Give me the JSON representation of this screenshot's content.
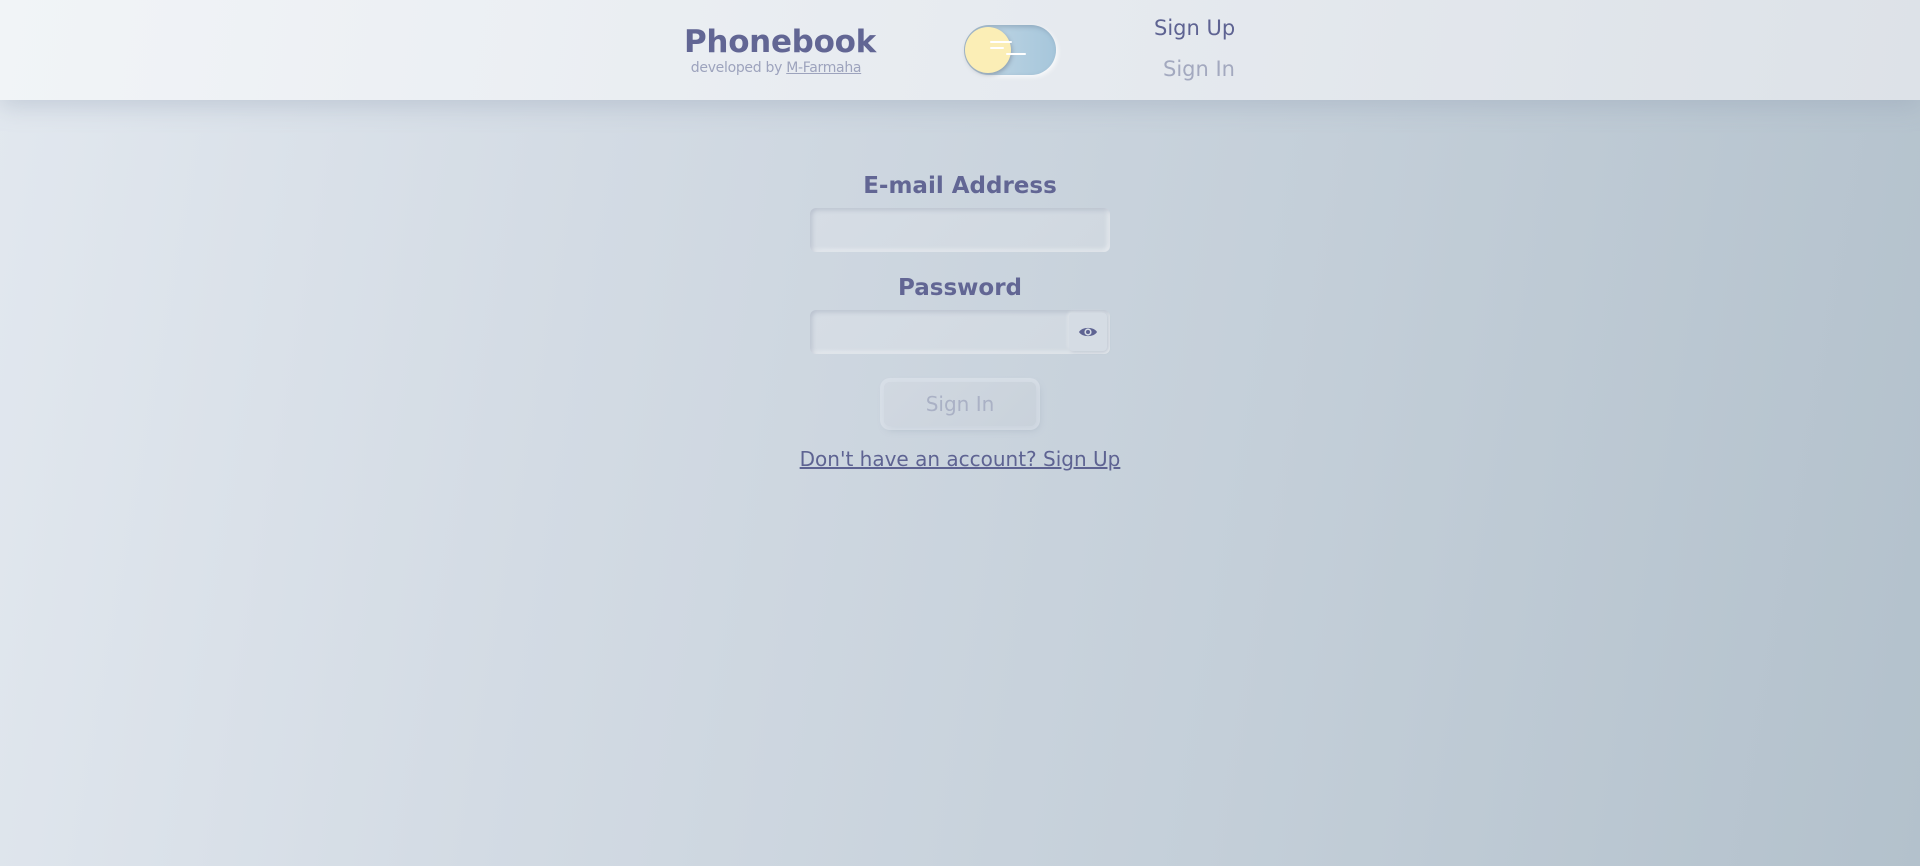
{
  "header": {
    "logo_title": "Phonebook",
    "logo_sub_prefix": "developed by ",
    "logo_sub_author": "M-Farmaha",
    "theme_toggle": {
      "state": "light",
      "knob_icon": "sun-icon",
      "lines_icon": "wind-lines-icon"
    },
    "nav": {
      "signup_label": "Sign Up",
      "signin_label": "Sign In"
    }
  },
  "form": {
    "email_label": "E-mail Address",
    "email_value": "",
    "email_placeholder": "",
    "password_label": "Password",
    "password_value": "",
    "password_placeholder": "",
    "eye_icon": "eye-icon",
    "submit_label": "Sign In",
    "switch_link": "Don't have an account? Sign Up"
  },
  "colors": {
    "primary_text": "#626694",
    "muted_text": "#a3a9bf",
    "toggle_knob": "#fbeeb6",
    "toggle_track": "#a6c6db"
  }
}
